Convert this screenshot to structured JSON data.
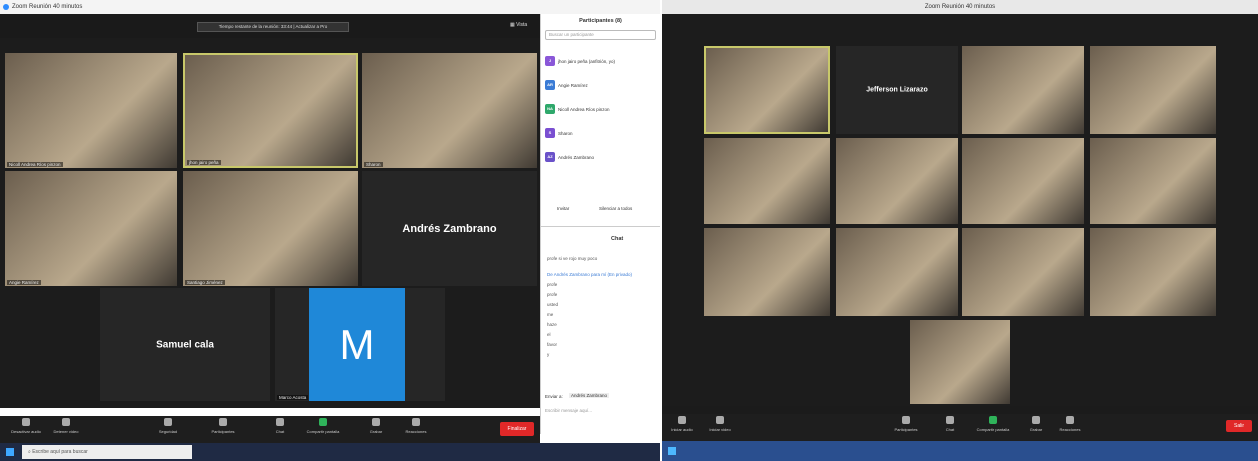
{
  "left": {
    "window_title": "Zoom Reunión 40 minutos",
    "banner": "Tiempo restante de la reunión: 33:44 | Actualizar a Pro",
    "view_label": "Vista",
    "participants": [
      {
        "name": "Nicoll Andrea Ríos pinzon"
      },
      {
        "name": "jhon jairo peña"
      },
      {
        "name": "Sharon"
      },
      {
        "name": "Angie Ramírez"
      },
      {
        "name": "Santiago Jiménez"
      },
      {
        "name": "Andrés Zambrano"
      },
      {
        "name": "Samuel cala"
      },
      {
        "name": "Marco Acosta",
        "avatar_letter": "M"
      }
    ],
    "controls": [
      "Desactivar audio",
      "Detener video",
      "Seguridad",
      "Participantes",
      "Chat",
      "Compartir pantalla",
      "Grabar",
      "Reacciones"
    ],
    "end_button": "Finalizar",
    "sidebar": {
      "participants_title": "Participantes (8)",
      "search_placeholder": "Buscar un participante",
      "list": [
        {
          "initials": "J",
          "name": "jhon jairo peña (anfitrión, yo)",
          "color": "#8a57d8"
        },
        {
          "initials": "AR",
          "name": "Angie Ramírez",
          "color": "#3a7bd5"
        },
        {
          "initials": "NA",
          "name": "Nicoll Andrea Ríos pinzon",
          "color": "#2ea86b"
        },
        {
          "initials": "S",
          "name": "Sharon",
          "color": "#7a4fd1"
        },
        {
          "initials": "AZ",
          "name": "Andrés Zambrano",
          "color": "#6a52c9"
        }
      ],
      "invite_label": "Invitar",
      "mute_all_label": "Silenciar a todos",
      "chat_title": "Chat",
      "chat_lines": [
        "profe si ve rojo  muy poco",
        "De Andrés Zambrano para mí (En privado)",
        "profe",
        "profe",
        "usted",
        "me",
        "haze",
        "el",
        "favor",
        "y"
      ],
      "send_to_label": "Enviar a:",
      "send_to_value": "Andrés Zambrano",
      "message_placeholder": "Escribir mensaje aquí..."
    },
    "taskbar_search": "Escribe aquí para buscar"
  },
  "right": {
    "window_title": "Zoom Reunión 40 minutos",
    "participants": [
      {
        "name": "Jefferson Lizarazo",
        "big_name": "Jefferson Lizarazo"
      }
    ],
    "controls": [
      "Iniciar audio",
      "Iniciar video",
      "Participantes",
      "Chat",
      "Compartir pantalla",
      "Grabar",
      "Reacciones"
    ],
    "end_button": "Salir"
  }
}
